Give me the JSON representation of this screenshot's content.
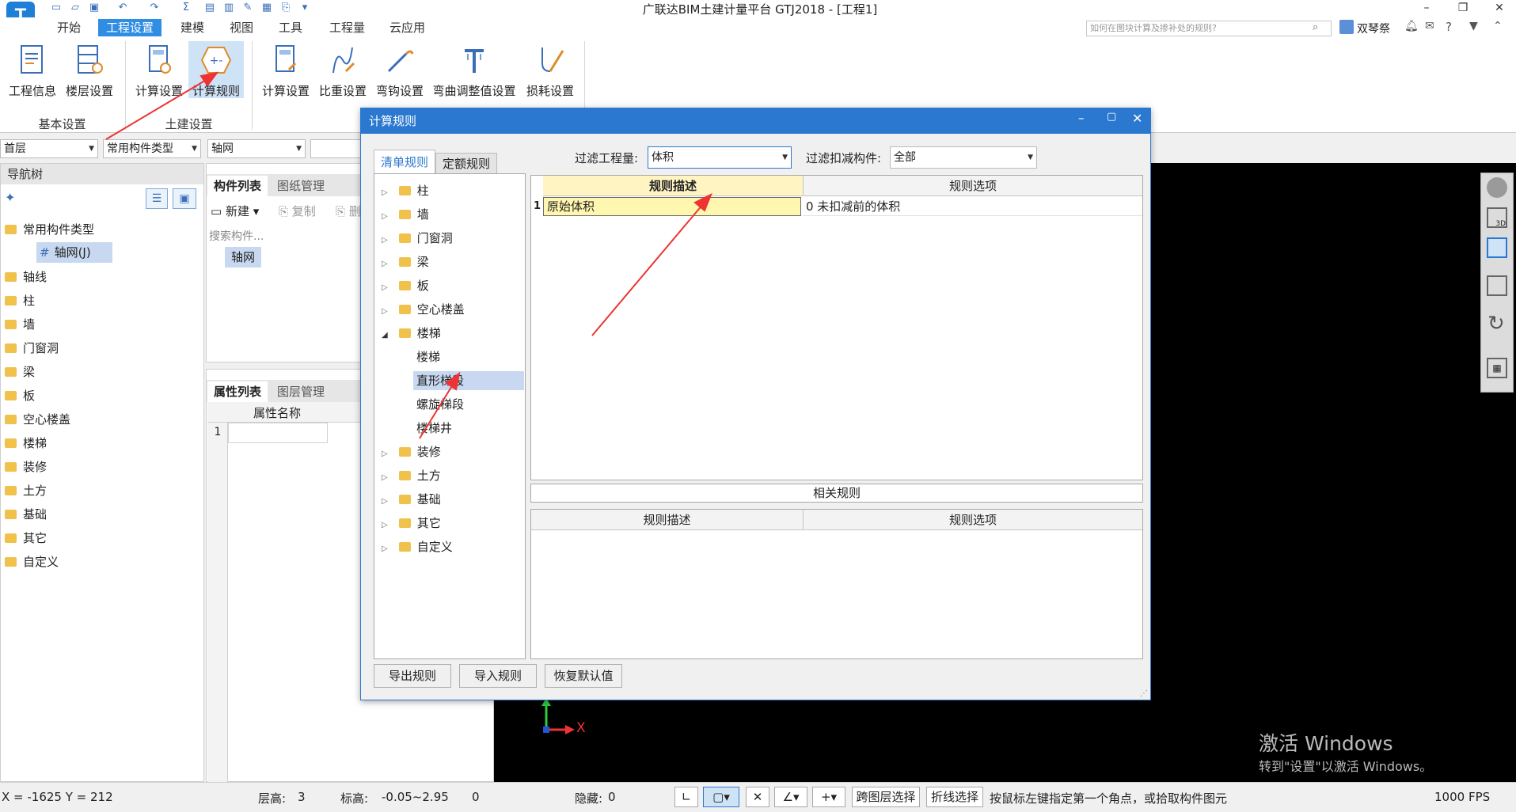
{
  "app": {
    "title": "广联达BIM土建计量平台 GTJ2018 - [工程1]",
    "logo": "T",
    "user": "双琴祭",
    "help_placeholder": "如何在图块计算及掺补处的规则?"
  },
  "menu": [
    "开始",
    "工程设置",
    "建模",
    "视图",
    "工具",
    "工程量",
    "云应用"
  ],
  "ribbon": {
    "basic": [
      "工程信息",
      "楼层设置"
    ],
    "basic_group": "基本设置",
    "civil": [
      "计算设置",
      "计算规则"
    ],
    "civil_group": "土建设置",
    "steel": [
      "计算设置",
      "比重设置",
      "弯钩设置",
      "弯曲调整值设置",
      "损耗设置"
    ]
  },
  "toolbar": {
    "floor": "首层",
    "type": "常用构件类型",
    "component": "轴网"
  },
  "nav": {
    "title": "导航树",
    "root": "常用构件类型",
    "selected": "轴网(J)",
    "items": [
      "轴线",
      "柱",
      "墙",
      "门窗洞",
      "梁",
      "板",
      "空心楼盖",
      "楼梯",
      "装修",
      "土方",
      "基础",
      "其它",
      "自定义"
    ]
  },
  "component_list": {
    "tabs": [
      "构件列表",
      "图纸管理"
    ],
    "actions": [
      "新建",
      "复制",
      "删"
    ],
    "search_placeholder": "搜索构件...",
    "item": "轴网"
  },
  "property": {
    "tabs": [
      "属性列表",
      "图层管理"
    ],
    "col": "属性名称",
    "row": "1"
  },
  "dialog": {
    "title": "计算规则",
    "tabs": [
      "清单规则",
      "定额规则"
    ],
    "filter_qty_label": "过滤工程量:",
    "filter_qty_value": "体积",
    "filter_deduct_label": "过滤扣减构件:",
    "filter_deduct_value": "全部",
    "tree": [
      {
        "label": "柱",
        "open": false
      },
      {
        "label": "墙",
        "open": false
      },
      {
        "label": "门窗洞",
        "open": false
      },
      {
        "label": "梁",
        "open": false
      },
      {
        "label": "板",
        "open": false
      },
      {
        "label": "空心楼盖",
        "open": false
      },
      {
        "label": "楼梯",
        "open": true
      }
    ],
    "stair_children": [
      "楼梯",
      "直形梯段",
      "螺旋梯段",
      "楼梯井"
    ],
    "tree_rest": [
      "装修",
      "土方",
      "基础",
      "其它",
      "自定义"
    ],
    "rule_header": [
      "规则描述",
      "规则选项"
    ],
    "rule_row": {
      "no": "1",
      "desc": "原始体积",
      "option": "0 未扣减前的体积"
    },
    "related_title": "相关规则",
    "related_header": [
      "规则描述",
      "规则选项"
    ],
    "buttons": [
      "导出规则",
      "导入规则",
      "恢复默认值"
    ]
  },
  "watermark": {
    "line1": "激活 Windows",
    "line2": "转到\"设置\"以激活 Windows。"
  },
  "axis_label": "X",
  "status": {
    "coords": "X = -1625 Y = 212",
    "floor_h_label": "层高:",
    "floor_h": "3",
    "elev_label": "标高:",
    "elev": "-0.05~2.95",
    "zero": "0",
    "hidden_label": "隐藏:",
    "hidden": "0",
    "cross_layer": "跨图层选择",
    "polyline": "折线选择",
    "hint": "按鼠标左键指定第一个角点，或拾取构件图元",
    "fps": "1000 FPS"
  },
  "colors": {
    "accent": "#2b78d0",
    "menu_active": "#2f8de4",
    "arrow": "#e33",
    "selected_row": "#fff7b0"
  }
}
